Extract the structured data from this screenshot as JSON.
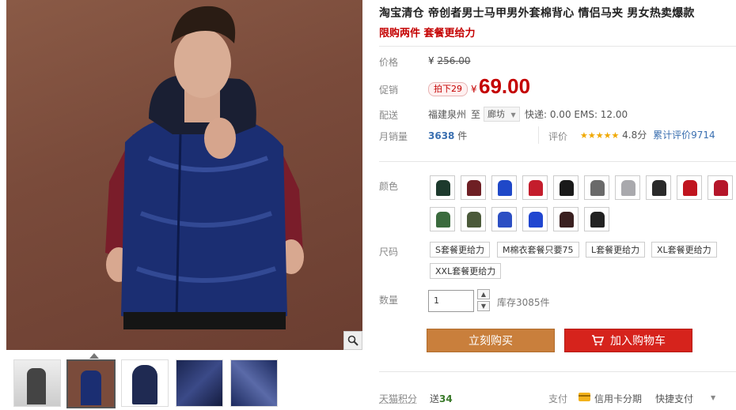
{
  "title": "淘宝清仓 帝创者男士马甲男外套棉背心 情侣马夹 男女热卖爆款",
  "subtitle": "限购两件 套餐更给力",
  "price": {
    "label": "价格",
    "original": "256.00",
    "currency": "¥"
  },
  "promo": {
    "label": "促销",
    "badge": "拍下29",
    "currency": "¥",
    "value": "69.00"
  },
  "shipping": {
    "label": "配送",
    "from": "福建泉州",
    "to_word": "至",
    "city": "廊坊",
    "fees": "快递: 0.00 EMS: 12.00"
  },
  "sales": {
    "label": "月销量",
    "count": "3638",
    "unit": "件",
    "rating_label": "评价",
    "stars": "★★★★★",
    "score": "4.8分",
    "total_reviews": "累计评价9714"
  },
  "colors": {
    "label": "颜色",
    "swatches": [
      "#1d3a2d",
      "#6e1f24",
      "#1f48c8",
      "#c41d2c",
      "#1a1a1a",
      "#6a6a6a",
      "#a9a9ad",
      "#2a2a2a",
      "#c0151f",
      "#b5162a",
      "#3b6b3e",
      "#4b5a3a",
      "#2c4fc3",
      "#2046d0",
      "#3a2020",
      "#222222"
    ]
  },
  "sizes": {
    "label": "尺码",
    "options": [
      "S套餐更给力",
      "M棉衣套餐只要75",
      "L套餐更给力",
      "XL套餐更给力",
      "XXL套餐更给力"
    ]
  },
  "quantity": {
    "label": "数量",
    "value": "1",
    "stock": "库存3085件"
  },
  "buttons": {
    "buy": "立刻购买",
    "cart": "加入购物车"
  },
  "footer": {
    "points_label": "天猫积分",
    "points": "送34",
    "points_value": "34",
    "points_prefix": "送",
    "pay_label": "支付",
    "credit": "信用卡分期",
    "quick": "快捷支付"
  }
}
